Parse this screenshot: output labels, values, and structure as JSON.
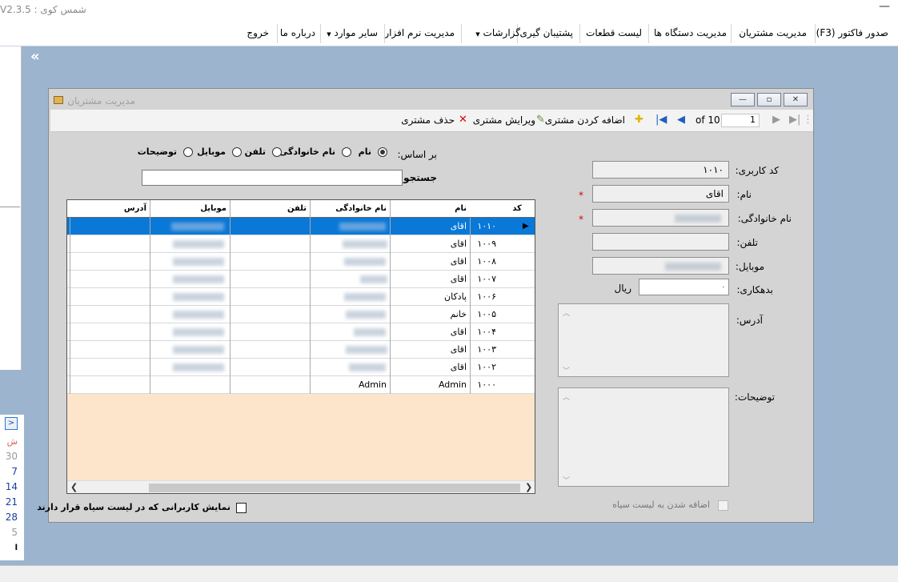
{
  "app": {
    "title": "V2.3.5 : شمس کوی",
    "minimize_glyph": "—"
  },
  "menu": {
    "items": [
      {
        "label": "صدور فاکتور (F3)",
        "dropdown": false
      },
      {
        "label": "مدیریت مشتریان",
        "dropdown": false
      },
      {
        "label": "مدیریت دستگاه ها",
        "dropdown": false
      },
      {
        "label": "لیست قطعات",
        "dropdown": false
      },
      {
        "label": "پشتیبان گیری",
        "dropdown": false
      },
      {
        "label": "گزارشات",
        "dropdown": true
      },
      {
        "label": "مدیریت نرم افزار",
        "dropdown": false
      },
      {
        "label": "سایر موارد",
        "dropdown": true
      },
      {
        "label": "درباره ما",
        "dropdown": false
      },
      {
        "label": "خروج",
        "dropdown": false
      }
    ]
  },
  "sidebar": {
    "collapse_glyph": "«",
    "calendar": {
      "nav": ">",
      "weekday": "ش",
      "days": [
        "30",
        "7",
        "14",
        "21",
        "28",
        "5"
      ],
      "footer": "ا"
    }
  },
  "form": {
    "title": "مدیریت مشتریان",
    "window_buttons": [
      "—",
      "▫",
      "✕"
    ],
    "toolbar": {
      "page_value": "1",
      "page_of": "of 10",
      "add_label": "اضافه کردن مشتری",
      "edit_label": "ویرایش مشتری",
      "delete_label": "حذف مشتری"
    },
    "search_by_label": "بر اساس:",
    "search_options": [
      {
        "label": "نام",
        "selected": true
      },
      {
        "label": "نام خانوادگی",
        "selected": false
      },
      {
        "label": "تلفن",
        "selected": false
      },
      {
        "label": "موبایل",
        "selected": false
      },
      {
        "label": "توضیحات",
        "selected": false
      }
    ],
    "search_label": "جستجو:",
    "search_value": "",
    "grid": {
      "columns": [
        "کد",
        "نام",
        "نام خانوادگی",
        "تلفن",
        "موبایل",
        "آدرس"
      ],
      "rows": [
        {
          "code": "۱۰۱۰",
          "name": "اقای",
          "family": "",
          "phone": "",
          "mobile": "",
          "address": ""
        },
        {
          "code": "۱۰۰۹",
          "name": "اقای",
          "family": "",
          "phone": "",
          "mobile": "",
          "address": ""
        },
        {
          "code": "۱۰۰۸",
          "name": "اقای",
          "family": "",
          "phone": "",
          "mobile": "",
          "address": ""
        },
        {
          "code": "۱۰۰۷",
          "name": "اقای",
          "family": "",
          "phone": "",
          "mobile": "",
          "address": ""
        },
        {
          "code": "۱۰۰۶",
          "name": "پادکان",
          "family": "",
          "phone": "",
          "mobile": "",
          "address": ""
        },
        {
          "code": "۱۰۰۵",
          "name": "خانم",
          "family": "",
          "phone": "",
          "mobile": "",
          "address": ""
        },
        {
          "code": "۱۰۰۴",
          "name": "اقای",
          "family": "",
          "phone": "",
          "mobile": "",
          "address": ""
        },
        {
          "code": "۱۰۰۳",
          "name": "اقای",
          "family": "",
          "phone": "",
          "mobile": "",
          "address": ""
        },
        {
          "code": "۱۰۰۲",
          "name": "اقای",
          "family": "",
          "phone": "",
          "mobile": "",
          "address": ""
        },
        {
          "code": "۱۰۰۰",
          "name": "Admin",
          "family": "Admin",
          "phone": "",
          "mobile": "",
          "address": ""
        }
      ],
      "selected_row": 0
    },
    "blacklist_show_label": "نمایش کاربرانی که در لیست سیاه قرار دارند",
    "details": {
      "code_label": "کد کاربری:",
      "code_value": "۱۰۱۰",
      "name_label": "نام:",
      "name_value": "اقای",
      "family_label": "نام خانوادگی:",
      "family_value": "",
      "phone_label": "تلفن:",
      "phone_value": "",
      "mobile_label": "موبایل:",
      "mobile_value": "",
      "debt_label": "بدهکاری:",
      "debt_value": "۰",
      "debt_unit": "ریال",
      "address_label": "آدرس:",
      "notes_label": "توضیحات:",
      "required_mark": "*",
      "blacklist_add_label": "اضافه شدن به لیست سیاه"
    }
  }
}
